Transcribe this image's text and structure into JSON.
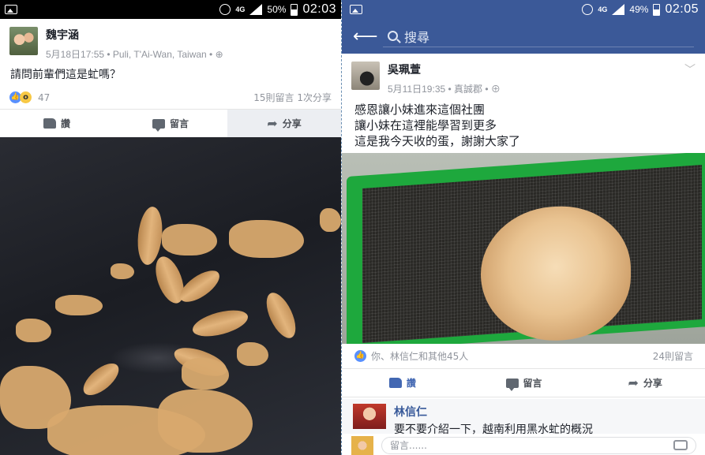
{
  "left": {
    "status": {
      "network": "4G",
      "battery": "50%",
      "time": "02:03"
    },
    "post": {
      "author": "魏宇涵",
      "meta": "5月18日17:55 • Puli, T'Ai-Wan, Taiwan • ⊕",
      "text": "請問前輩們這是虻嗎？",
      "reactions_count": "47",
      "comments_shares": "15則留言 1次分享"
    },
    "actions": {
      "like": "讚",
      "comment": "留言",
      "share": "分享"
    }
  },
  "right": {
    "status": {
      "network": "4G",
      "battery": "49%",
      "time": "02:05"
    },
    "search": {
      "placeholder": "搜尋"
    },
    "post": {
      "author": "吳珮萱",
      "meta": "5月11日19:35 • 真誠郡 • ⊕",
      "text_lines": [
        "感恩讓小妹進來這個社團",
        "讓小妹在這裡能學習到更多",
        "這是我今天收的蛋，謝謝大家了"
      ],
      "likers": "你、林信仁和其他45人",
      "comments": "24則留言"
    },
    "actions": {
      "like": "讚",
      "comment": "留言",
      "share": "分享"
    },
    "comment": {
      "author": "林信仁",
      "text": "要不要介紹一下，越南利用黑水虻的概況"
    },
    "reply": {
      "placeholder": "留言......"
    }
  },
  "colors": {
    "facebook_blue": "#3b5998",
    "like_blue": "#4267b2"
  }
}
